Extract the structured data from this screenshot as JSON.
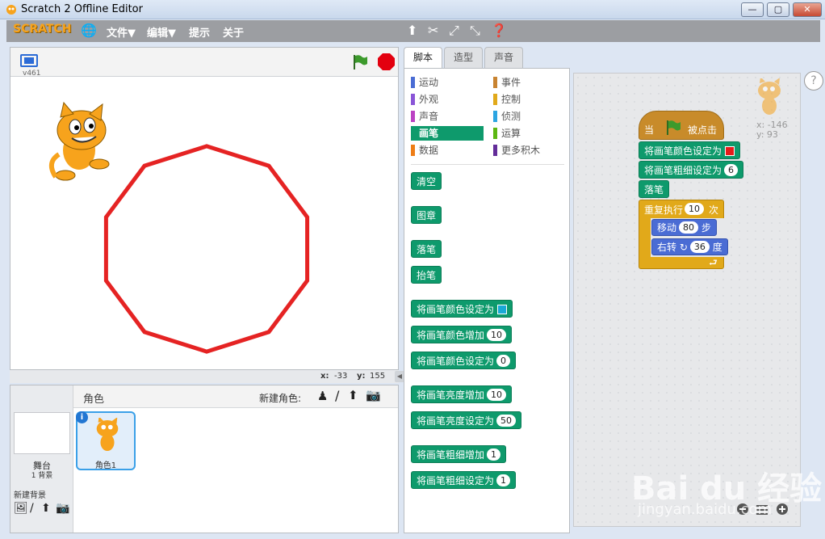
{
  "window": {
    "title": "Scratch 2 Offline Editor",
    "min_label": "—",
    "max_label": "▢",
    "close_label": "✕"
  },
  "menubar": {
    "logo": "SCRATCH",
    "file": "文件▼",
    "edit": "编辑▼",
    "tips": "提示",
    "about": "关于",
    "icons": [
      "duplicate-icon",
      "delete-icon",
      "grow-icon",
      "shrink-icon",
      "help-icon"
    ]
  },
  "stage": {
    "version": "v461",
    "coord_x_label": "x:",
    "coord_x": "-33",
    "coord_y_label": "y:",
    "coord_y": "155",
    "polygon_color": "#e52323",
    "polygon_sides": 10
  },
  "sprites": {
    "title": "角色",
    "new_sprite_label": "新建角色:",
    "stage_label": "舞台",
    "backdrop_count": "1 背景",
    "new_backdrop_label": "新建背景",
    "sprite_name": "角色1",
    "info_label": "i"
  },
  "tabs": [
    {
      "label": "脚本",
      "active": true
    },
    {
      "label": "造型",
      "active": false
    },
    {
      "label": "声音",
      "active": false
    }
  ],
  "categories": [
    {
      "label": "运动",
      "color": "#4a6cd4"
    },
    {
      "label": "事件",
      "color": "#c88330"
    },
    {
      "label": "外观",
      "color": "#8a55d7"
    },
    {
      "label": "控制",
      "color": "#e1a91a"
    },
    {
      "label": "声音",
      "color": "#bb42c3"
    },
    {
      "label": "侦测",
      "color": "#2ca5e2"
    },
    {
      "label": "画笔",
      "color": "#0e9a6c",
      "selected": true
    },
    {
      "label": "运算",
      "color": "#5cb712"
    },
    {
      "label": "数据",
      "color": "#ee7d16"
    },
    {
      "label": "更多积木",
      "color": "#632d99"
    }
  ],
  "palette_blocks": {
    "clear": "清空",
    "stamp": "图章",
    "pen_down": "落笔",
    "pen_up": "抬笔",
    "set_color_to": "将画笔颜色设定为",
    "change_color_by": "将画笔颜色增加",
    "change_color_val": "10",
    "set_color_num": "将画笔颜色设定为",
    "set_color_num_val": "0",
    "change_shade_by": "将画笔亮度增加",
    "change_shade_val": "10",
    "set_shade_to": "将画笔亮度设定为",
    "set_shade_val": "50",
    "change_size_by": "将画笔粗细增加",
    "change_size_val": "1",
    "set_size_to": "将画笔粗细设定为",
    "set_size_val": "1",
    "swatch_color": "#19a9d6"
  },
  "script": {
    "hat_when": "当",
    "hat_clicked": "被点击",
    "set_color": "将画笔颜色设定为",
    "set_color_swatch": "#e51b1b",
    "set_size": "将画笔粗细设定为",
    "set_size_val": "6",
    "pen_down": "落笔",
    "repeat": "重复执行",
    "repeat_val": "10",
    "repeat_unit": "次",
    "move": "移动",
    "move_val": "80",
    "move_unit": "步",
    "turn": "右转",
    "turn_val": "36",
    "turn_unit": "度",
    "loop_arrow": "⮐"
  },
  "sprite_info": {
    "x": "x: -146",
    "y": "y: 93"
  },
  "help": "?",
  "watermark": {
    "main": "Bai du 经验",
    "sub": "jingyan.baidu.com"
  }
}
